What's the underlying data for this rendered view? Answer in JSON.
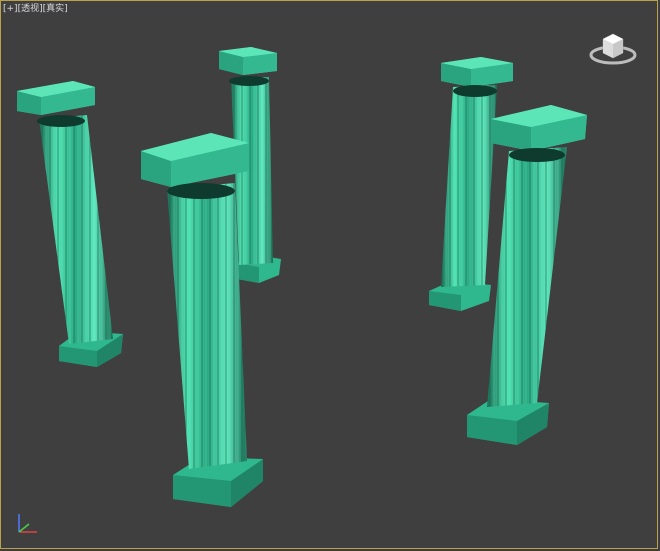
{
  "viewport": {
    "labels": [
      "[+]",
      "[透视]",
      "[真实]"
    ],
    "selection_color": "#b9a24a"
  },
  "scene": {
    "object_color": "#3fd0a0",
    "object_dark": "#1e7f62",
    "object_light": "#6bf0c4"
  },
  "icons": {
    "viewcube": "viewcube-icon",
    "axis": "axis-tripod-icon"
  }
}
